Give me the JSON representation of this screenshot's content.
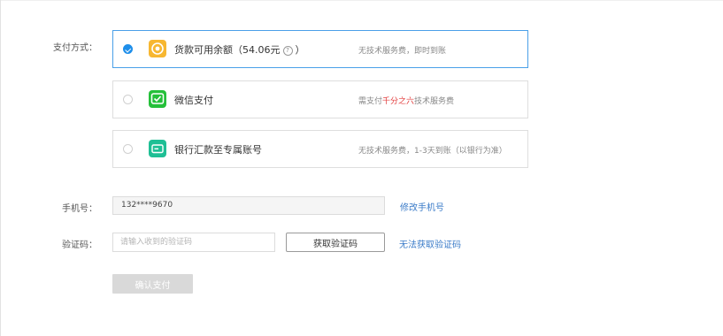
{
  "payment": {
    "label": "支付方式：",
    "options": [
      {
        "title": "货款可用余额（54.06元",
        "title_suffix": "）",
        "help_glyph": "?",
        "note": "无技术服务费，即时到账",
        "selected": true,
        "icon": "coin-icon",
        "icon_color": "#f7b731"
      },
      {
        "title": "微信支付",
        "note_prefix": "需支付",
        "note_highlight": "千分之六",
        "note_suffix": "技术服务费",
        "selected": false,
        "icon": "wechat-icon",
        "icon_color": "#25c03a"
      },
      {
        "title": "银行汇款至专属账号",
        "note": "无技术服务费，1-3天到账（以银行为准）",
        "selected": false,
        "icon": "bank-card-icon",
        "icon_color": "#1fbf95"
      }
    ]
  },
  "phone": {
    "label": "手机号：",
    "value": "132****9670",
    "modify_link": "修改手机号"
  },
  "verification": {
    "label": "验证码：",
    "placeholder": "请输入收到的验证码",
    "get_code_button": "获取验证码",
    "cannot_get_link": "无法获取验证码"
  },
  "confirm_button": "确认支付",
  "colors": {
    "accent": "#1f8fea",
    "link": "#3a7bc8",
    "highlight": "#e23b3b",
    "disabled_button": "#d9d9d9"
  }
}
